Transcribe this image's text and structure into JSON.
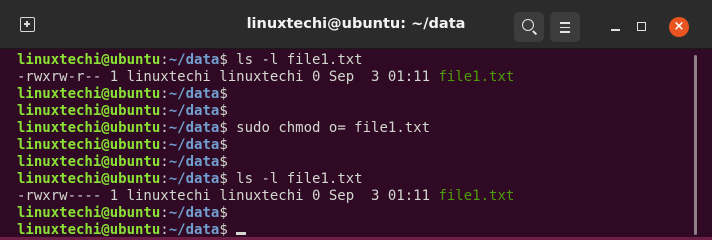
{
  "window": {
    "title": "linuxtechi@ubuntu: ~/data",
    "close_glyph": "×",
    "icons": [
      "new-tab-icon",
      "search-icon",
      "menu-icon",
      "minimize-icon",
      "maximize-icon",
      "close-icon"
    ]
  },
  "colors": {
    "terminal_bg": "#300a24",
    "user": "#8ae234",
    "path": "#729fcf",
    "file": "#4e9a06",
    "close": "#e95420"
  },
  "terminal": {
    "user_host": "linuxtechi@ubuntu",
    "path": "~/data",
    "lines": [
      {
        "type": "prompt",
        "command": " ls -l file1.txt"
      },
      {
        "type": "output",
        "text": "-rwxrw-r-- 1 linuxtechi linuxtechi 0 Sep  3 01:11 ",
        "file": "file1.txt"
      },
      {
        "type": "prompt",
        "command": ""
      },
      {
        "type": "prompt",
        "command": ""
      },
      {
        "type": "prompt",
        "command": " sudo chmod o= file1.txt"
      },
      {
        "type": "prompt",
        "command": ""
      },
      {
        "type": "prompt",
        "command": ""
      },
      {
        "type": "prompt",
        "command": " ls -l file1.txt"
      },
      {
        "type": "output",
        "text": "-rwxrw---- 1 linuxtechi linuxtechi 0 Sep  3 01:11 ",
        "file": "file1.txt"
      },
      {
        "type": "prompt",
        "command": ""
      },
      {
        "type": "prompt",
        "command": " ",
        "cursor": true
      }
    ]
  }
}
